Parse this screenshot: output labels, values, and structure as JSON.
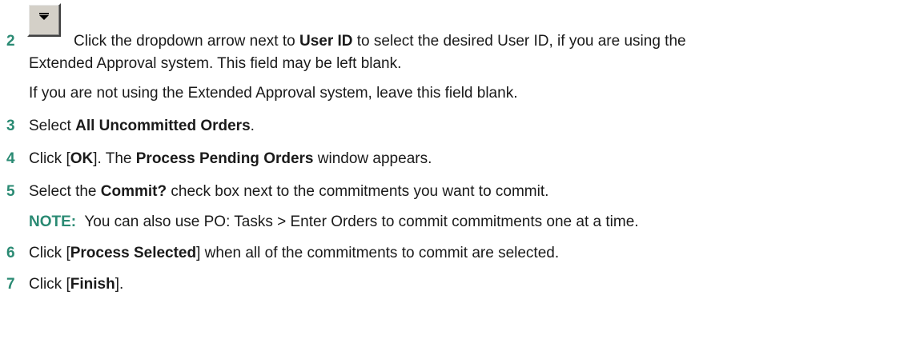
{
  "steps": [
    {
      "number": "2",
      "pre": "Click the dropdown arrow next to ",
      "bold": "User ID",
      "post": " to select the desired User ID, if you are using the",
      "continuation": "Extended Approval system. This field may be left blank.",
      "extra": "If you are not using the Extended Approval system, leave this field blank."
    },
    {
      "number": "3",
      "pre": "Select ",
      "bold": "All Uncommitted Orders",
      "post": "."
    },
    {
      "number": "4",
      "pre": "Click [",
      "bold": "OK",
      "mid": "]. The ",
      "bold2": "Process Pending Orders",
      "post": " window appears."
    },
    {
      "number": "5",
      "pre": "Select the ",
      "bold": "Commit?",
      "post": " check box next to the commitments you want to commit.",
      "note_label": "NOTE:",
      "note_text": "  You can also use PO: Tasks > Enter Orders to commit commitments one at a time."
    },
    {
      "number": "6",
      "pre": "Click [",
      "bold": "Process Selected",
      "post": "] when all of the commitments to commit are selected."
    },
    {
      "number": "7",
      "pre": "Click [",
      "bold": "Finish",
      "post": "]."
    }
  ],
  "dropdown_button": {
    "icon": "chevron-down-icon"
  }
}
